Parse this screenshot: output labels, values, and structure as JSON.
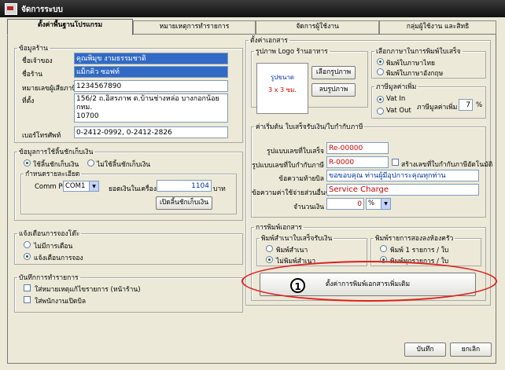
{
  "window": {
    "title": "จัดการระบบ"
  },
  "tabs": [
    "ตั้งค่าพื้นฐานโปรแกรม",
    "หมายเหตุการทำรายการ",
    "จัดการผู้ใช้งาน",
    "กลุ่มผู้ใช้งาน และสิทธิ"
  ],
  "store": {
    "legend": "ข้อมูลร้าน",
    "owner_label": "ชื่อเจ้าของ",
    "owner_value": "คุณพิมุข งามธรรมชาติ",
    "store_label": "ชื่อร้าน",
    "store_value": "แม็กคิว ซอฟท์",
    "tax_label": "หมายเลขผู้เสียภาษี",
    "tax_value": "1234567890",
    "address_label": "ที่ตั้ง",
    "address_line1": "156/2 ถ.อิสรภาพ  ต.บ้านช่างหล่อ บางกอกน้อย กทม.",
    "address_line2": "10700",
    "phone_label": "เบอร์โทรศัพท์",
    "phone_value": "0-2412-0992, 0-2412-2826"
  },
  "cash_drawer": {
    "legend": "ข้อมูลการใช้ลิ้นชักเก็บเงิน",
    "use_label": "ใช้ลิ้นชักเก็บเงิน",
    "nouse_label": "ไม่ใช้ลิ้นชักเก็บเงิน",
    "detail_legend": "กำหนดรายละเอียด",
    "port_label": "Comm Port",
    "port_value": "COM1",
    "balance_label": "ยอดเงินในเครื่อง",
    "balance_value": "1104",
    "unit": "บาท",
    "open_button": "เปิดลิ้นชักเก็บเงิน"
  },
  "alert": {
    "legend": "แจ้งเตือนการจองโต๊ะ",
    "opt1": "ไม่มีการเตือน",
    "opt2": "แจ้งเตือนการจอง"
  },
  "log": {
    "legend": "บันทึกการทำรายการ",
    "opt1": "ใส่หมายเหตุแก้ไขรายการ (หน้าร้าน)",
    "opt2": "ใส่พนักงานเปิดบิล"
  },
  "doc_settings": {
    "legend": "ตั้งค่าเอกสาร",
    "logo_legend": "รูปภาพ Logo ร้านอาหาร",
    "logo_size_line1": "รูปขนาด",
    "logo_size_line2": "3 x 3 ซม.",
    "select_image": "เลือกรูปภาพ",
    "delete_image": "ลบรูปภาพ"
  },
  "print_lang": {
    "legend": "เลือกภาษาในการพิมพ์ใบเสร็จ",
    "opt_thai": "พิมพ์ใบภาษาไทย",
    "opt_eng": "พิมพ์ใบภาษาอังกฤษ"
  },
  "vat": {
    "legend": "ภาษีมูลค่าเพิ่ม",
    "vat_in": "Vat In",
    "vat_out": "Vat Out",
    "rate_label": "ภาษีมูลค่าเพิ่ม",
    "rate_value": "7",
    "pct": "%"
  },
  "receipt": {
    "legend": "ค่าเริ่มต้น ใบเสร็จรับเงิน/ใบกำกับภาษี",
    "receipt_fmt_label": "รูปแบบเลขที่ใบเสร็จ",
    "receipt_fmt_value": "Re-00000",
    "tax_fmt_label": "รูปแบบเลขที่ใบกำกับภาษี",
    "tax_fmt_value": "R-0000",
    "auto_label": "สร้างเลขที่ใบกำกับภาษีอัตโนมัติ",
    "footer_label": "ข้อความท้ายบิล",
    "footer_value": "ขอขอบคุณ ท่านผู้มีอุปการะคุณทุกท่าน",
    "service_label": "ข้อความค่าใช้จ่ายส่วนอื่นๆ",
    "service_value": "Service Charge",
    "amount_label": "จำนวนเงิน",
    "amount_value": "0",
    "amount_unit": "%"
  },
  "printing": {
    "legend": "การพิมพ์เอกสาร",
    "receipt_legend": "พิมพ์สำเนาใบเสร็จรับเงิน",
    "copy_yes": "พิมพ์สำเนา",
    "copy_no": "ไม่พิมพ์สำเนา",
    "kitchen_legend": "พิมพ์รายการสองลงห้องครัว",
    "kitchen_opt1": "พิมพ์ 1 รายการ / ใบ",
    "kitchen_opt2": "พิมพ์ทุกรายการ / ใบ",
    "more_button": "ตั้งค่าการพิมพ์เอกสารเพิ่มเติม"
  },
  "callout": {
    "number": "1",
    "color": "#e02020"
  },
  "footer": {
    "save": "บันทึก",
    "cancel": "ยกเลิก"
  }
}
